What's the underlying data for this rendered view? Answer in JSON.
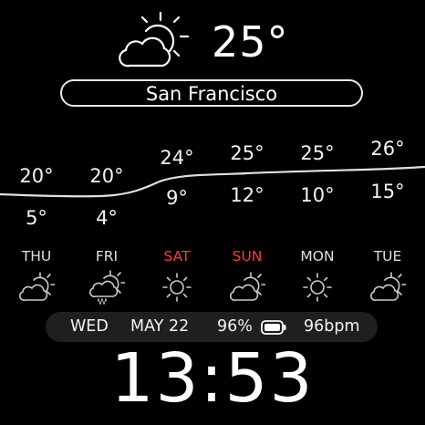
{
  "current": {
    "icon": "partly-cloudy-icon",
    "temperature": "25°",
    "city": "San Francisco"
  },
  "forecast": [
    {
      "day": "THU",
      "high": "20°",
      "low": "5°",
      "icon": "partly-cloudy-icon",
      "weekend": false
    },
    {
      "day": "FRI",
      "high": "20°",
      "low": "4°",
      "icon": "sun-cloud-rain-icon",
      "weekend": false
    },
    {
      "day": "SAT",
      "high": "24°",
      "low": "9°",
      "icon": "sun-icon",
      "weekend": true
    },
    {
      "day": "SUN",
      "high": "25°",
      "low": "12°",
      "icon": "partly-cloudy-icon",
      "weekend": true
    },
    {
      "day": "MON",
      "high": "25°",
      "low": "10°",
      "icon": "sun-icon",
      "weekend": false
    },
    {
      "day": "TUE",
      "high": "26°",
      "low": "15°",
      "icon": "partly-cloudy-icon",
      "weekend": false
    }
  ],
  "status": {
    "weekday": "WED",
    "date": "MAY 22",
    "battery": "96%",
    "battery_icon": "battery-icon",
    "heart_rate": "96bpm"
  },
  "time": "13:53",
  "colors": {
    "background": "#000000",
    "text": "#ffffff",
    "weekend": "#ff3b30",
    "status_bar": "#1f1f1f"
  }
}
